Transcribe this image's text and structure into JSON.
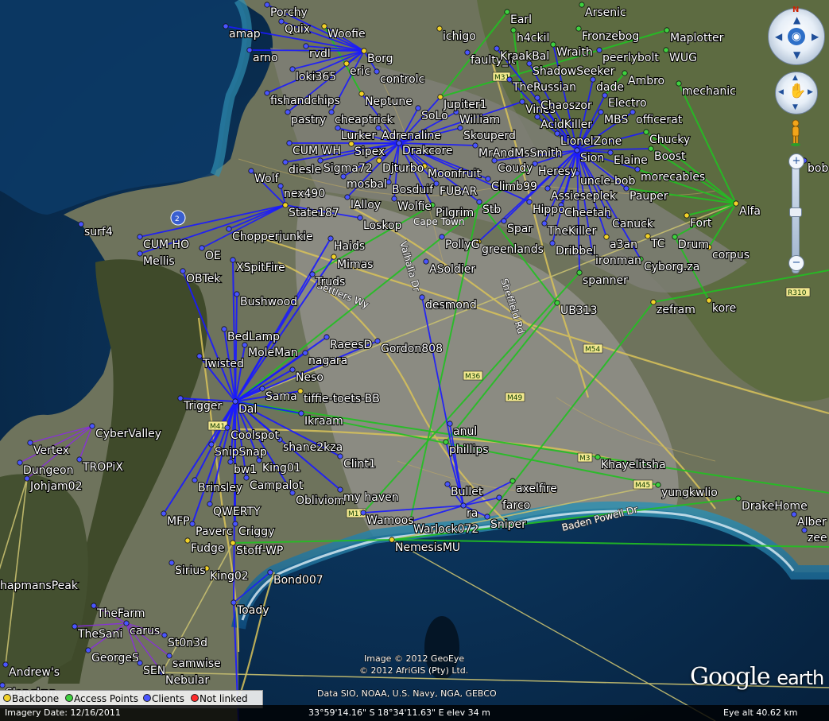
{
  "app": "Google Earth",
  "legend": {
    "backbone": "Backbone",
    "access_points": "Access Points",
    "clients": "Clients",
    "not_linked": "Not linked"
  },
  "status": {
    "imagery_date": "Imagery Date: 12/16/2011",
    "coords": "33°59'14.16\" S   18°34'11.63\" E  elev   34 m",
    "eye_alt": "Eye alt    40.62 km"
  },
  "credits": [
    "Image © 2012 GeoEye",
    "© 2012 AfriGIS (Pty) Ltd.",
    "Data SIO, NOAA, U.S. Navy, NGA, GEBCO"
  ],
  "logo": {
    "google": "Google",
    "earth": "earth"
  },
  "colors": {
    "backbone": "#c8c070",
    "access": "#22c022",
    "client": "#1a1aff",
    "water": "#0d3560",
    "land": "#5a6b3a",
    "urban": "#8c8c86"
  },
  "icons": {
    "look": "eye-icon",
    "move": "hand-icon",
    "street_view": "pegman-icon",
    "zoom_in": "plus-icon",
    "zoom_out": "minus-icon"
  },
  "roads": [
    "Cape Town",
    "Valhalla Dr",
    "Settlers Wy",
    "Sheffield Rd",
    "Baden Powell Dr",
    "M31",
    "M54",
    "M36",
    "M49",
    "M41",
    "M3",
    "M45",
    "M17",
    "R310",
    "2"
  ],
  "nodes": [
    "Porchy",
    "Quix",
    "amap",
    "Woofie",
    "ichigo",
    "Earl",
    "Arsenic",
    "h4ckil",
    "Fronzebog",
    "Maplotter",
    "arno",
    "rvdl",
    "Borg",
    "faulty_it",
    "KraakBal",
    "Wraith",
    "peerlybolt",
    "WUG",
    "eric",
    "controlc",
    "loki365",
    "ShadowSeeker",
    "Ambro",
    "mechanic",
    "TheRussian",
    "dade",
    "fishandchips",
    "Neptune",
    "Jupiter1",
    "Vines",
    "Chaoszor",
    "Electro",
    "pastry",
    "cheaptrick",
    "SoLo",
    "William",
    "AcidKiller",
    "MBS",
    "officerat",
    "Lurker",
    "Adrenaline",
    "Skouperd",
    "LionelZone",
    "Chucky",
    "CUM WH",
    "Sipex",
    "Drakcore",
    "MrAndMsSmith",
    "Sion",
    "Elaine",
    "Boost",
    "diesle",
    "Sigma72",
    "Djturbo",
    "Coudy",
    "Heresy",
    "bob",
    "Wolf",
    "mosbal",
    "Moonfruit",
    "uncle-bob",
    "morecables",
    "nex490",
    "Bosduif",
    "FUBAR",
    "Climb99",
    "lAlloy",
    "Wolfie",
    "Assieseplek",
    "Pauper",
    "State187",
    "Pilgrim",
    "Stb",
    "Hippo",
    "Cheetah",
    "Alfa",
    "surf4",
    "Loskop",
    "Canuck",
    "Fort",
    "Chopperjunkie",
    "Spar",
    "TheKiller",
    "CUM HO",
    "Haids",
    "PollyG",
    "greenlands",
    "Dribbel",
    "a3an",
    "TC",
    "Drum",
    "Mellis",
    "OE",
    "Mimas",
    "ASoldier",
    "ironman",
    "Cyborg.za",
    "corpus",
    "XSpitFire",
    "OBTek",
    "Truds",
    "spanner",
    "Bushwood",
    "desmond",
    "UB313",
    "zefram",
    "kore",
    "BedLamp",
    "RaeesD",
    "Gordon808",
    "MoleMan",
    "nagara",
    "Twisted",
    "Neso",
    "Sama",
    "tiffie-toets-BB",
    "Trigger",
    "Dal",
    "Ikraam",
    "CyberValley",
    "Coolspot",
    "Vertex",
    "shane2kza",
    "anul",
    "Dungeon",
    "TROPiX",
    "SnipSnap",
    "phillips",
    "King01",
    "Clint1",
    "Johjam02",
    "bw1",
    "Khayelitsha",
    "Brinsley",
    "Campalot",
    "Obliviom",
    "my haven",
    "Bullet",
    "axelfire",
    "yungkwlio",
    "DrakeHome",
    "Alber",
    "MFP",
    "QWERTY",
    "farco",
    "Paverc",
    "Criggy",
    "Wamoos",
    "ra",
    "Sniper",
    "Warlock072",
    "zee",
    "Fudge",
    "Stoff-WP",
    "NemesisMU",
    "Sirius",
    "King02",
    "Bond007",
    "hapmansPeak",
    "Toady",
    "TheFarm",
    "TheSani",
    "carus",
    "St0n3d",
    "GeorgeS",
    "samwise",
    "Andrew's",
    "SEN",
    "Nebular",
    "Slangkop"
  ]
}
